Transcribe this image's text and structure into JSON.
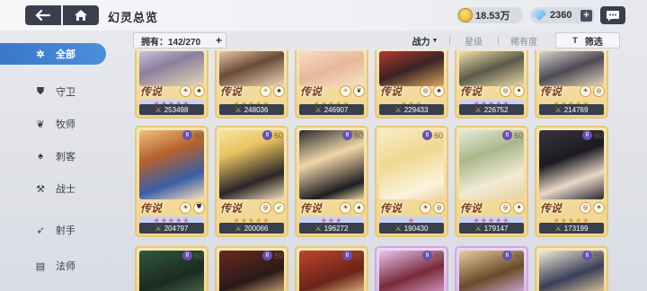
{
  "header": {
    "title": "幻灵总览",
    "gold": "18.53万",
    "gems": "2360",
    "plus": "+"
  },
  "sidebar": {
    "items": [
      {
        "label": "全部",
        "icon": "all-icon"
      },
      {
        "label": "守卫",
        "icon": "shield-icon"
      },
      {
        "label": "牧师",
        "icon": "wings-icon"
      },
      {
        "label": "刺客",
        "icon": "hood-icon"
      },
      {
        "label": "战士",
        "icon": "axe-icon"
      },
      {
        "label": "射手",
        "icon": "bow-icon"
      },
      {
        "label": "法师",
        "icon": "book-icon"
      }
    ]
  },
  "filters": {
    "owned": "拥有：142/270",
    "expand": "+",
    "sort_power": "战力",
    "sort_power_arrow": "▼",
    "sort_star": "星级",
    "sort_rarity": "稀有度",
    "filter_label": "筛选",
    "filter_icon": "T"
  },
  "cards_row1": [
    {
      "power": "253498",
      "rarity": "传说",
      "stars": "★★★★★"
    },
    {
      "power": "248036",
      "rarity": "传说",
      "stars": "★★★★★"
    },
    {
      "power": "246907",
      "rarity": "传说",
      "stars": "★★★★★"
    },
    {
      "power": "229433",
      "rarity": "传说",
      "stars": "★★★"
    },
    {
      "power": "226752",
      "rarity": "传说",
      "stars": "★★★★★"
    },
    {
      "power": "214769",
      "rarity": "传说",
      "stars": "★★★★★"
    }
  ],
  "cards_row2": [
    {
      "power": "204797",
      "rarity": "传说",
      "level": "60",
      "stars": "★★★★★"
    },
    {
      "power": "200066",
      "rarity": "传说",
      "level": "60",
      "stars": "★★★★★"
    },
    {
      "power": "196272",
      "rarity": "传说",
      "level": "60",
      "stars": "★★★"
    },
    {
      "power": "190430",
      "rarity": "传说",
      "level": "60",
      "stars": "★"
    },
    {
      "power": "179147",
      "rarity": "传说",
      "level": "60",
      "stars": "★★★★★"
    },
    {
      "power": "173199",
      "rarity": "传说",
      "level": "60",
      "stars": "★★★★★"
    }
  ],
  "cards_row3": [
    {
      "level": "60"
    },
    {
      "level": "59"
    },
    {
      "level": "60"
    },
    {
      "level": "60"
    },
    {
      "level": "60"
    },
    {
      "level": "59"
    }
  ],
  "colors": {
    "accent": "#3a78c9",
    "card_gold": "#f1d58e",
    "card_purple": "#dcb8e6",
    "power_bar": "#3b3f4d"
  }
}
